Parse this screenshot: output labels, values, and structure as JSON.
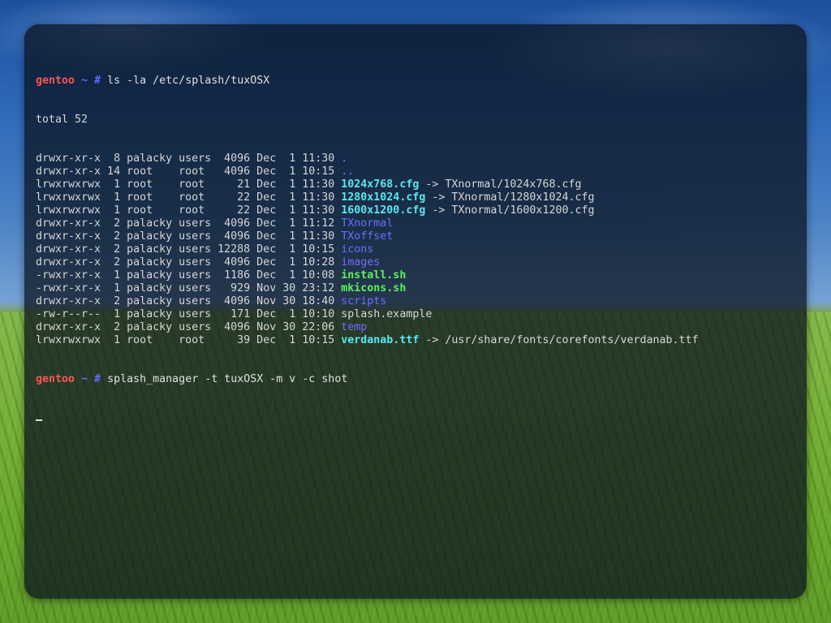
{
  "desktop": {
    "wallpaper_description_colors": {
      "sky": "#2e69b8",
      "grass": "#79b23a"
    }
  },
  "terminal": {
    "background": "#0a121e",
    "colors": {
      "host": "#ff5555",
      "prompt": "#5c6cff",
      "directory": "#6c6cff",
      "symlink": "#56e8f0",
      "executable": "#5cf25c",
      "text": "#d6d6d6"
    },
    "prompt": {
      "host": "gentoo",
      "cwd": "~",
      "symbol": "#"
    },
    "command1": "ls -la /etc/splash/tuxOSX",
    "total": "total 52",
    "listing": [
      {
        "meta": "drwxr-xr-x  8 palacky users  4096 Dec  1 11:30 ",
        "name": ".",
        "kind": "dir",
        "target": ""
      },
      {
        "meta": "drwxr-xr-x 14 root    root   4096 Dec  1 10:15 ",
        "name": "..",
        "kind": "dir",
        "target": ""
      },
      {
        "meta": "lrwxrwxrwx  1 root    root     21 Dec  1 11:30 ",
        "name": "1024x768.cfg",
        "kind": "link",
        "target": " -> TXnormal/1024x768.cfg"
      },
      {
        "meta": "lrwxrwxrwx  1 root    root     22 Dec  1 11:30 ",
        "name": "1280x1024.cfg",
        "kind": "link",
        "target": " -> TXnormal/1280x1024.cfg"
      },
      {
        "meta": "lrwxrwxrwx  1 root    root     22 Dec  1 11:30 ",
        "name": "1600x1200.cfg",
        "kind": "link",
        "target": " -> TXnormal/1600x1200.cfg"
      },
      {
        "meta": "drwxr-xr-x  2 palacky users  4096 Dec  1 11:12 ",
        "name": "TXnormal",
        "kind": "dir",
        "target": ""
      },
      {
        "meta": "drwxr-xr-x  2 palacky users  4096 Dec  1 11:30 ",
        "name": "TXoffset",
        "kind": "dir",
        "target": ""
      },
      {
        "meta": "drwxr-xr-x  2 palacky users 12288 Dec  1 10:15 ",
        "name": "icons",
        "kind": "dir",
        "target": ""
      },
      {
        "meta": "drwxr-xr-x  2 palacky users  4096 Dec  1 10:28 ",
        "name": "images",
        "kind": "dir",
        "target": ""
      },
      {
        "meta": "-rwxr-xr-x  1 palacky users  1186 Dec  1 10:08 ",
        "name": "install.sh",
        "kind": "exe",
        "target": ""
      },
      {
        "meta": "-rwxr-xr-x  1 palacky users   929 Nov 30 23:12 ",
        "name": "mkicons.sh",
        "kind": "exe",
        "target": ""
      },
      {
        "meta": "drwxr-xr-x  2 palacky users  4096 Nov 30 18:40 ",
        "name": "scripts",
        "kind": "dir",
        "target": ""
      },
      {
        "meta": "-rw-r--r--  1 palacky users   171 Dec  1 10:10 ",
        "name": "splash.example",
        "kind": "plain",
        "target": ""
      },
      {
        "meta": "drwxr-xr-x  2 palacky users  4096 Nov 30 22:06 ",
        "name": "temp",
        "kind": "dir",
        "target": ""
      },
      {
        "meta": "lrwxrwxrwx  1 root    root     39 Dec  1 10:15 ",
        "name": "verdanab.ttf",
        "kind": "link",
        "target": " -> /usr/share/fonts/corefonts/verdanab.ttf"
      }
    ],
    "command2": "splash_manager -t tuxOSX -m v -c shot"
  }
}
